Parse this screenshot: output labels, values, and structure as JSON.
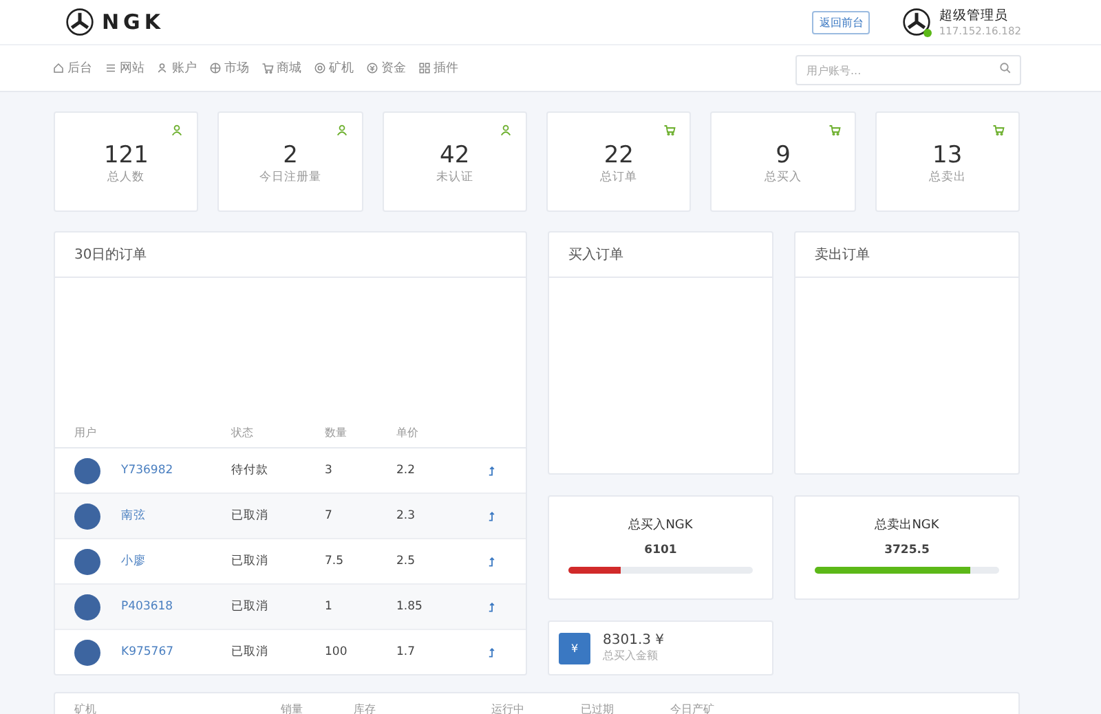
{
  "header": {
    "logo_text": "NGK",
    "back_button": "返回前台",
    "user": {
      "name": "超级管理员",
      "ip": "117.152.16.182",
      "online": true
    }
  },
  "nav": {
    "items": [
      {
        "label": "后台"
      },
      {
        "label": "网站"
      },
      {
        "label": "账户"
      },
      {
        "label": "市场"
      },
      {
        "label": "商城"
      },
      {
        "label": "矿机"
      },
      {
        "label": "资金"
      },
      {
        "label": "插件"
      }
    ],
    "search": {
      "placeholder": "用户账号..."
    }
  },
  "stats": [
    {
      "value": "121",
      "label": "总人数",
      "kind": "user"
    },
    {
      "value": "2",
      "label": "今日注册量",
      "kind": "user"
    },
    {
      "value": "42",
      "label": "未认证",
      "kind": "user"
    },
    {
      "value": "22",
      "label": "总订单",
      "kind": "cart"
    },
    {
      "value": "9",
      "label": "总买入",
      "kind": "cart"
    },
    {
      "value": "13",
      "label": "总卖出",
      "kind": "cart"
    }
  ],
  "orders_panel": {
    "title": "30日的订单",
    "columns": [
      "用户",
      "状态",
      "数量",
      "单价"
    ],
    "rows": [
      {
        "user": "Y736982",
        "status": "待付款",
        "quantity": "3",
        "price": "2.2"
      },
      {
        "user": "南弦",
        "status": "已取消",
        "quantity": "7",
        "price": "2.3"
      },
      {
        "user": "小廖",
        "status": "已取消",
        "quantity": "7.5",
        "price": "2.5"
      },
      {
        "user": "P403618",
        "status": "已取消",
        "quantity": "1",
        "price": "1.85"
      },
      {
        "user": "K975767",
        "status": "已取消",
        "quantity": "100",
        "price": "1.7"
      }
    ]
  },
  "buy_orders": {
    "title": "买入订单"
  },
  "sell_orders": {
    "title": "卖出订单"
  },
  "totals": [
    {
      "title": "总买入NGK",
      "value": "6101",
      "level": 0.28,
      "color": "#d12a2a"
    },
    {
      "title": "总卖出NGK",
      "value": "3725.5",
      "level": 0.84,
      "color": "#5cb818"
    }
  ],
  "amount": {
    "icon": "¥",
    "value": "8301.3 ¥",
    "label": "总买入金额"
  },
  "miners_table": {
    "columns": [
      "矿机",
      "销量",
      "库存",
      "运行中",
      "已过期",
      "今日产矿"
    ]
  }
}
